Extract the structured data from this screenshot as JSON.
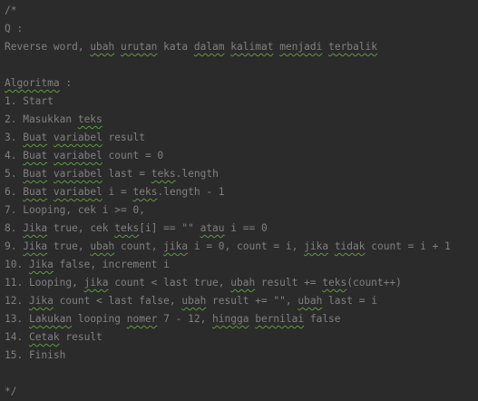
{
  "editor": {
    "lines": [
      [
        {
          "t": "/*"
        }
      ],
      [
        {
          "t": "Q :"
        }
      ],
      [
        {
          "t": "Reverse word, "
        },
        {
          "t": "ubah",
          "w": true
        },
        {
          "t": " "
        },
        {
          "t": "urutan",
          "w": true
        },
        {
          "t": " kata "
        },
        {
          "t": "dalam",
          "w": true
        },
        {
          "t": " "
        },
        {
          "t": "kalimat",
          "w": true
        },
        {
          "t": " "
        },
        {
          "t": "menjadi",
          "w": true
        },
        {
          "t": " "
        },
        {
          "t": "terbalik",
          "w": true
        }
      ],
      [
        {
          "t": ""
        }
      ],
      [
        {
          "t": "Algoritma",
          "w": true
        },
        {
          "t": " :"
        }
      ],
      [
        {
          "t": "1. Start"
        }
      ],
      [
        {
          "t": "2. Masukkan "
        },
        {
          "t": "teks",
          "w": true
        }
      ],
      [
        {
          "t": "3. "
        },
        {
          "t": "Buat",
          "w": true
        },
        {
          "t": " "
        },
        {
          "t": "variabel",
          "w": true
        },
        {
          "t": " result"
        }
      ],
      [
        {
          "t": "4. "
        },
        {
          "t": "Buat",
          "w": true
        },
        {
          "t": " "
        },
        {
          "t": "variabel",
          "w": true
        },
        {
          "t": " count = 0"
        }
      ],
      [
        {
          "t": "5. "
        },
        {
          "t": "Buat",
          "w": true
        },
        {
          "t": " "
        },
        {
          "t": "variabel",
          "w": true
        },
        {
          "t": " last = "
        },
        {
          "t": "teks",
          "w": true
        },
        {
          "t": ".length"
        }
      ],
      [
        {
          "t": "6. "
        },
        {
          "t": "Buat",
          "w": true
        },
        {
          "t": " "
        },
        {
          "t": "variabel",
          "w": true
        },
        {
          "t": " i = "
        },
        {
          "t": "teks",
          "w": true
        },
        {
          "t": ".length - 1"
        }
      ],
      [
        {
          "t": "7. Looping, cek i >= 0,"
        }
      ],
      [
        {
          "t": "8. "
        },
        {
          "t": "Jika",
          "w": true
        },
        {
          "t": " true, cek "
        },
        {
          "t": "teks",
          "w": true
        },
        {
          "t": "[i] == \"\" "
        },
        {
          "t": "atau",
          "w": true
        },
        {
          "t": " i == 0"
        }
      ],
      [
        {
          "t": "9. "
        },
        {
          "t": "Jika",
          "w": true
        },
        {
          "t": " true, "
        },
        {
          "t": "ubah",
          "w": true
        },
        {
          "t": " count, "
        },
        {
          "t": "jika",
          "w": true
        },
        {
          "t": " i = 0, count = i, "
        },
        {
          "t": "jika",
          "w": true
        },
        {
          "t": " "
        },
        {
          "t": "tidak",
          "w": true
        },
        {
          "t": " count = i + 1"
        }
      ],
      [
        {
          "t": "10. "
        },
        {
          "t": "Jika",
          "w": true
        },
        {
          "t": " false, increment i"
        }
      ],
      [
        {
          "t": "11. Looping, "
        },
        {
          "t": "jika",
          "w": true
        },
        {
          "t": " count < last true, "
        },
        {
          "t": "ubah",
          "w": true
        },
        {
          "t": " result += "
        },
        {
          "t": "teks",
          "w": true
        },
        {
          "t": "(count++)"
        }
      ],
      [
        {
          "t": "12. "
        },
        {
          "t": "Jika",
          "w": true
        },
        {
          "t": " count < last false, "
        },
        {
          "t": "ubah",
          "w": true
        },
        {
          "t": " result += \"\", "
        },
        {
          "t": "ubah",
          "w": true
        },
        {
          "t": " last = i"
        }
      ],
      [
        {
          "t": "13. "
        },
        {
          "t": "Lakukan",
          "w": true
        },
        {
          "t": " looping "
        },
        {
          "t": "nomer",
          "w": true
        },
        {
          "t": " 7 - 12, "
        },
        {
          "t": "hingga",
          "w": true
        },
        {
          "t": " "
        },
        {
          "t": "bernilai",
          "w": true
        },
        {
          "t": " false"
        }
      ],
      [
        {
          "t": "14. "
        },
        {
          "t": "Cetak",
          "w": true
        },
        {
          "t": " result"
        }
      ],
      [
        {
          "t": "15. Finish"
        }
      ],
      [
        {
          "t": ""
        }
      ],
      [
        {
          "t": "*/"
        }
      ]
    ]
  },
  "colors": {
    "background": "#2b2b2b",
    "comment_text": "#808080",
    "spellcheck_underline": "#5d9a3f"
  }
}
